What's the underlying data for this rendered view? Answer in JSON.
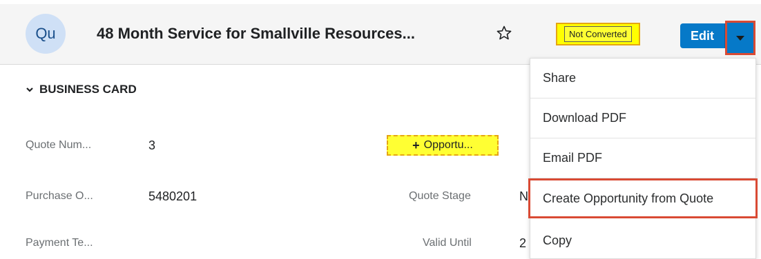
{
  "header": {
    "avatar_text": "Qu",
    "title": "48 Month Service for Smallville Resources...",
    "favorite_icon": "star-outline-icon",
    "status": "Not Converted",
    "edit_label": "Edit",
    "dropdown_icon": "caret-down-icon",
    "colors": {
      "primary": "#0679c8",
      "highlight_border": "#d94a34",
      "badge_bg": "#ffff00"
    }
  },
  "panel": {
    "title": "BUSINESS CARD",
    "collapse_icon": "chevron-down-icon"
  },
  "fields": [
    {
      "label": "Quote Num...",
      "value": "3"
    },
    {
      "label": "Purchase O...",
      "value": "5480201"
    },
    {
      "label": "Payment Te...",
      "value": ""
    }
  ],
  "right_fields": [
    {
      "label": "Quote Stage",
      "value": "N"
    },
    {
      "label": "Valid Until",
      "value": "2"
    }
  ],
  "opportunity_chip": {
    "label": "Opportu...",
    "icon": "plus-icon"
  },
  "actions_menu": {
    "items": [
      {
        "label": "Share"
      },
      {
        "label": "Download PDF"
      },
      {
        "label": "Email PDF"
      },
      {
        "label": "Create Opportunity from Quote"
      },
      {
        "label": "Copy"
      }
    ]
  }
}
